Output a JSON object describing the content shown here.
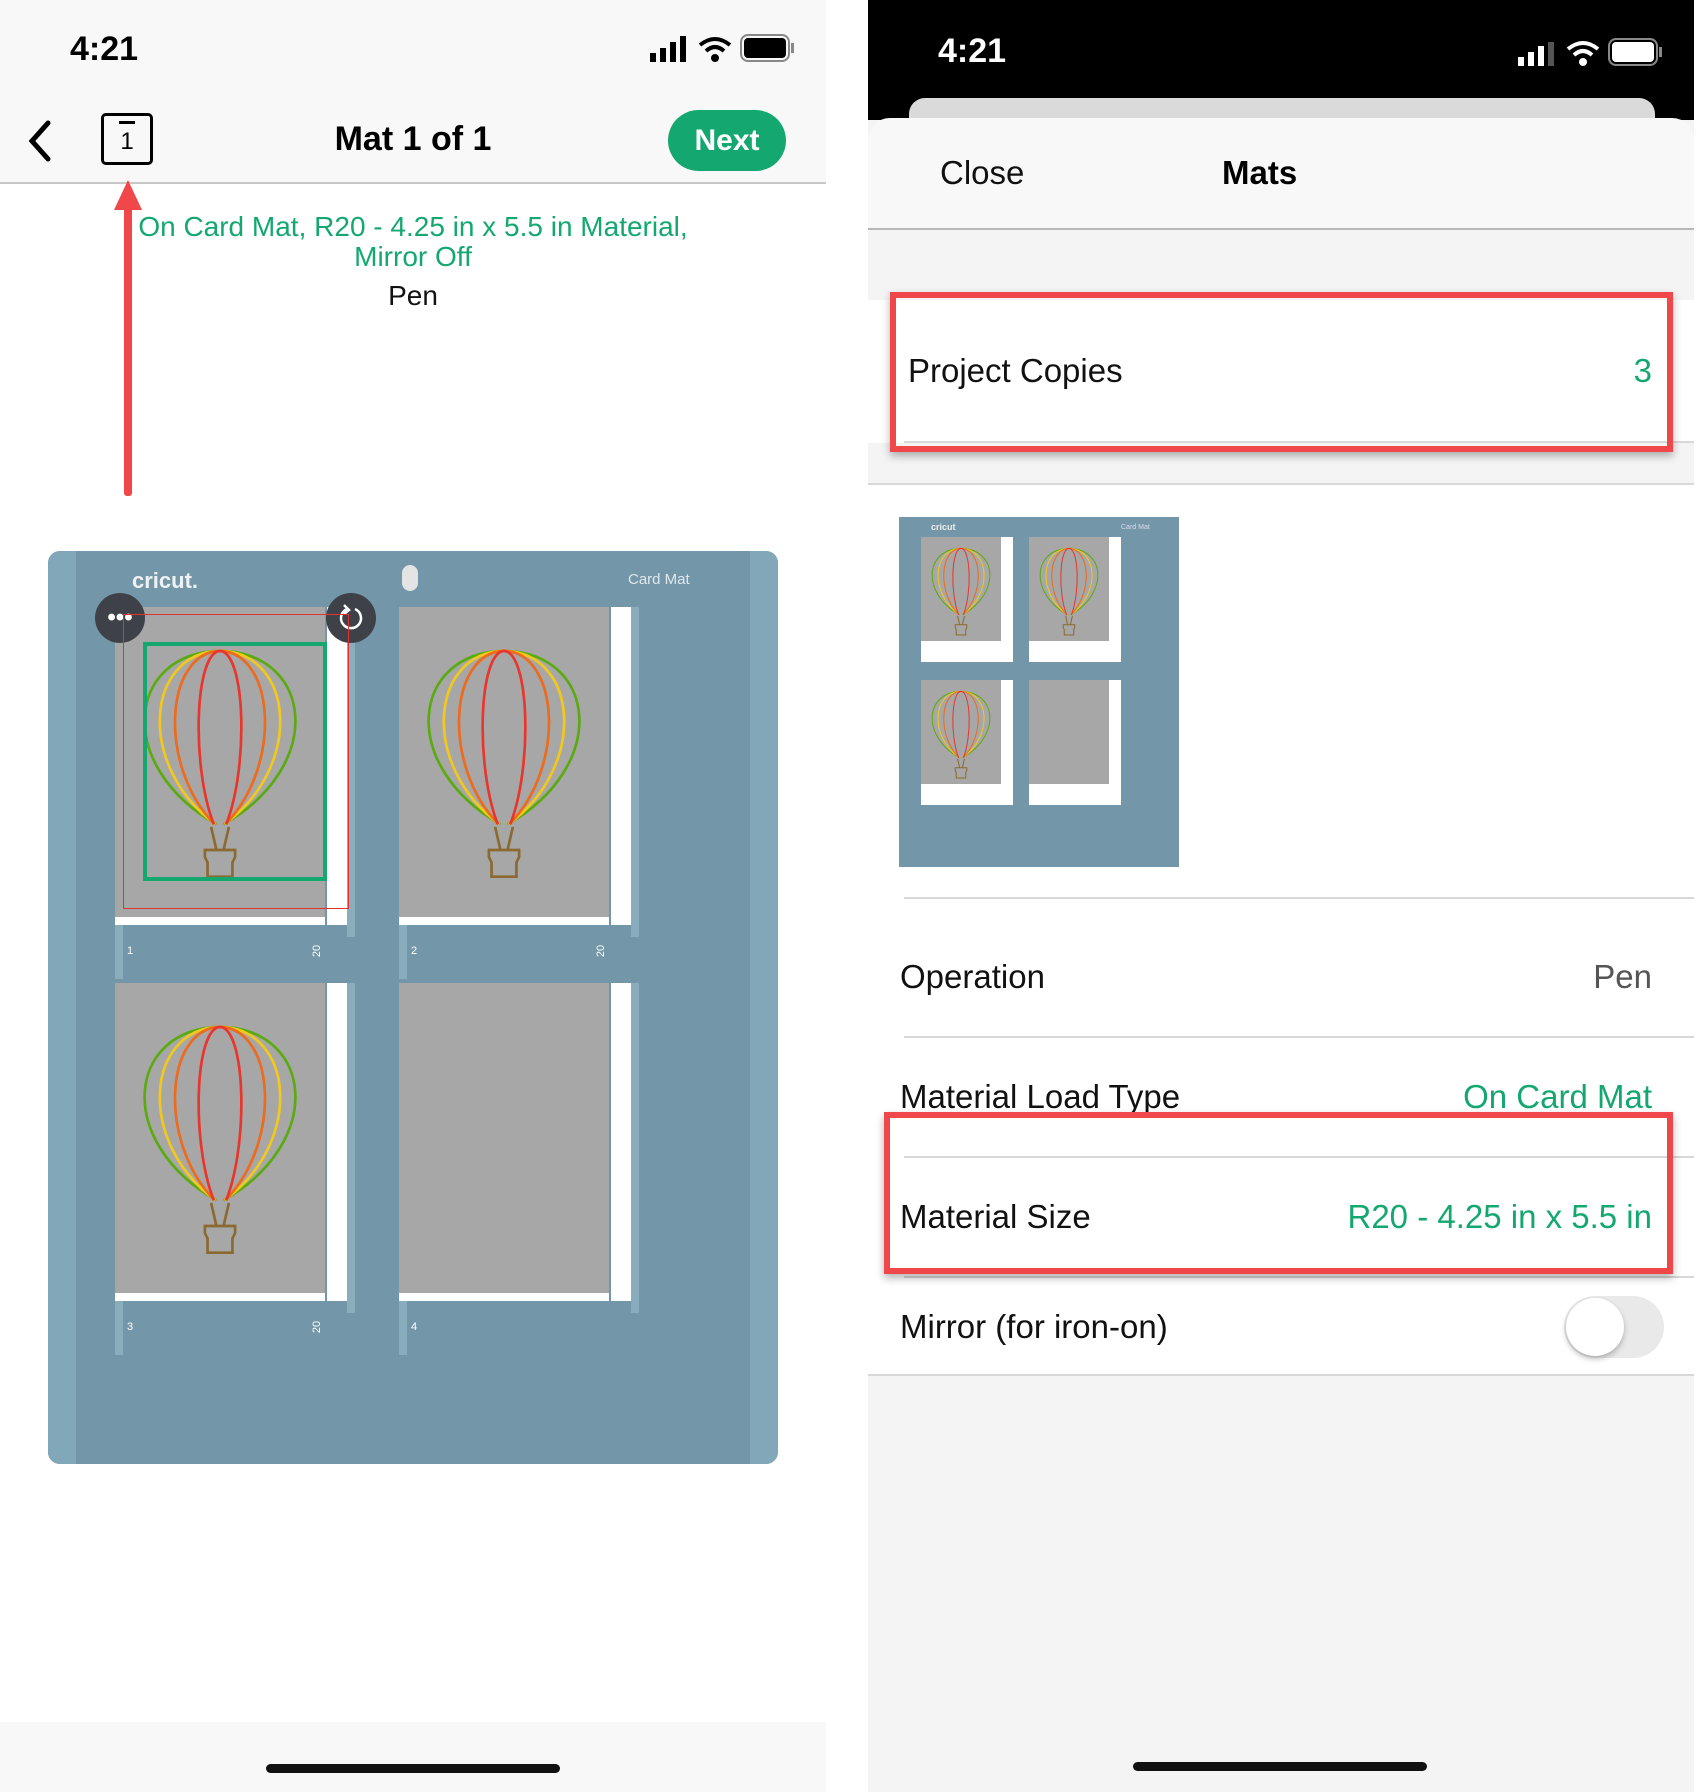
{
  "left": {
    "status": {
      "time": "4:21"
    },
    "nav": {
      "back": "back",
      "mat_index": "1",
      "title": "Mat 1 of 1",
      "next_label": "Next"
    },
    "summary": {
      "line1": "On Card Mat, R20 - 4.25 in x 5.5 in Material,",
      "line2": "Mirror Off",
      "operation": "Pen"
    },
    "mat": {
      "brand": "cricut.",
      "type": "Card Mat",
      "cells": [
        {
          "number": "1",
          "ruler": "20",
          "has_design": true
        },
        {
          "number": "2",
          "ruler": "20",
          "has_design": true
        },
        {
          "number": "3",
          "ruler": "20",
          "has_design": true
        },
        {
          "number": "4",
          "ruler": "",
          "has_design": false
        }
      ]
    },
    "icons": {
      "more": "more-icon",
      "rotate": "rotate-icon"
    }
  },
  "right": {
    "status": {
      "time": "4:21"
    },
    "header": {
      "close_label": "Close",
      "title": "Mats"
    },
    "project_copies": {
      "label": "Project Copies",
      "value": "3"
    },
    "thumbnail": {
      "brand": "cricut",
      "type": "Card Mat"
    },
    "rows": [
      {
        "label": "Operation",
        "value": "Pen"
      },
      {
        "label": "Material Load Type",
        "value": "On Card Mat"
      },
      {
        "label": "Material Size",
        "value": "R20 - 4.25 in x 5.5 in"
      }
    ],
    "mirror": {
      "label": "Mirror (for iron-on)",
      "on": false
    }
  },
  "colors": {
    "accent": "#14a870",
    "annotation": "#f0474a",
    "mat": "#7396a8"
  }
}
